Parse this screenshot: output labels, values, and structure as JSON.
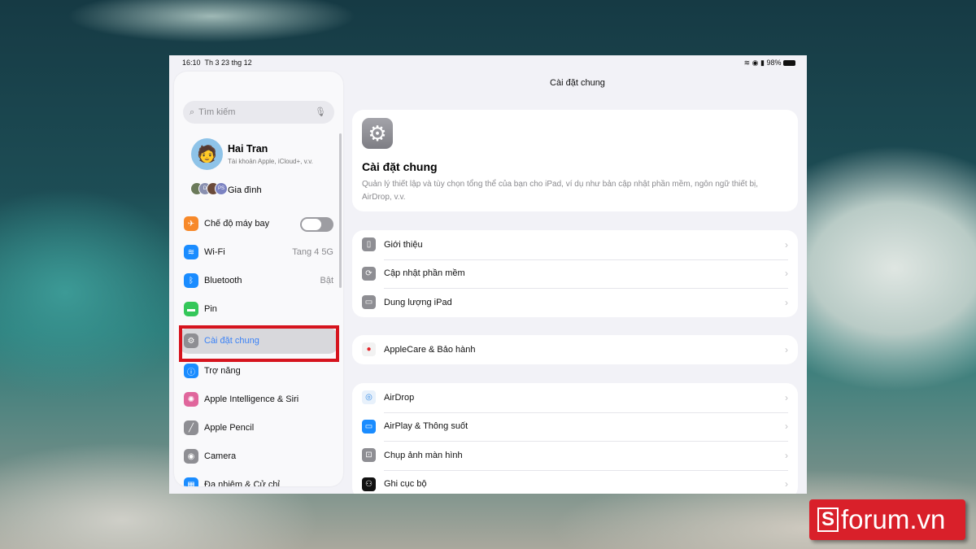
{
  "status": {
    "time": "16:10",
    "date": "Th 3 23 thg 12",
    "battery": "98%"
  },
  "sidebar": {
    "search_placeholder": "Tìm kiếm",
    "user": {
      "name": "Hai Tran",
      "subtitle": "Tài khoản Apple, iCloud+, v.v."
    },
    "family": {
      "label": "Gia đình",
      "badges": [
        "D",
        "PS"
      ]
    },
    "items": [
      {
        "label": "Chế độ máy bay",
        "icon": "airplane-icon",
        "color": "#f7892a",
        "toggle": false
      },
      {
        "label": "Wi-Fi",
        "icon": "wifi-icon",
        "color": "#1a8cff",
        "value": "Tang 4 5G"
      },
      {
        "label": "Bluetooth",
        "icon": "bluetooth-icon",
        "color": "#1a8cff",
        "value": "Bật"
      },
      {
        "label": "Pin",
        "icon": "battery-icon",
        "color": "#34c759"
      },
      {
        "label": "Cài đặt chung",
        "icon": "gear-icon",
        "color": "#8e8e93",
        "selected": true
      },
      {
        "label": "Trợ năng",
        "icon": "accessibility-icon",
        "color": "#1a8cff"
      },
      {
        "label": "Apple Intelligence & Siri",
        "icon": "apple-intelligence-icon",
        "color": "#e0669c"
      },
      {
        "label": "Apple Pencil",
        "icon": "pencil-icon",
        "color": "#8e8e93"
      },
      {
        "label": "Camera",
        "icon": "camera-icon",
        "color": "#8e8e93"
      },
      {
        "label": "Đa nhiệm & Cử chỉ",
        "icon": "multitasking-icon",
        "color": "#1a8cff"
      }
    ]
  },
  "main": {
    "nav_title": "Cài đặt chung",
    "header": {
      "title": "Cài đặt chung",
      "description": "Quản lý thiết lập và tùy chọn tổng thể của bạn cho iPad, ví dụ như bản cập nhật phần mềm, ngôn ngữ thiết bị, AirDrop, v.v."
    },
    "groups": [
      [
        {
          "label": "Giới thiệu",
          "icon": "ipad-icon"
        },
        {
          "label": "Cập nhật phần mềm",
          "icon": "software-update-icon"
        },
        {
          "label": "Dung lượng iPad",
          "icon": "storage-icon"
        }
      ],
      [
        {
          "label": "AppleCare & Bảo hành",
          "icon": "apple-icon"
        }
      ],
      [
        {
          "label": "AirDrop",
          "icon": "airdrop-icon"
        },
        {
          "label": "AirPlay & Thông suốt",
          "icon": "airplay-icon"
        },
        {
          "label": "Chụp ảnh màn hình",
          "icon": "screenshot-icon"
        },
        {
          "label": "Ghi cục bộ",
          "icon": "local-capture-icon"
        }
      ]
    ]
  },
  "watermark": "Sforum.vn"
}
